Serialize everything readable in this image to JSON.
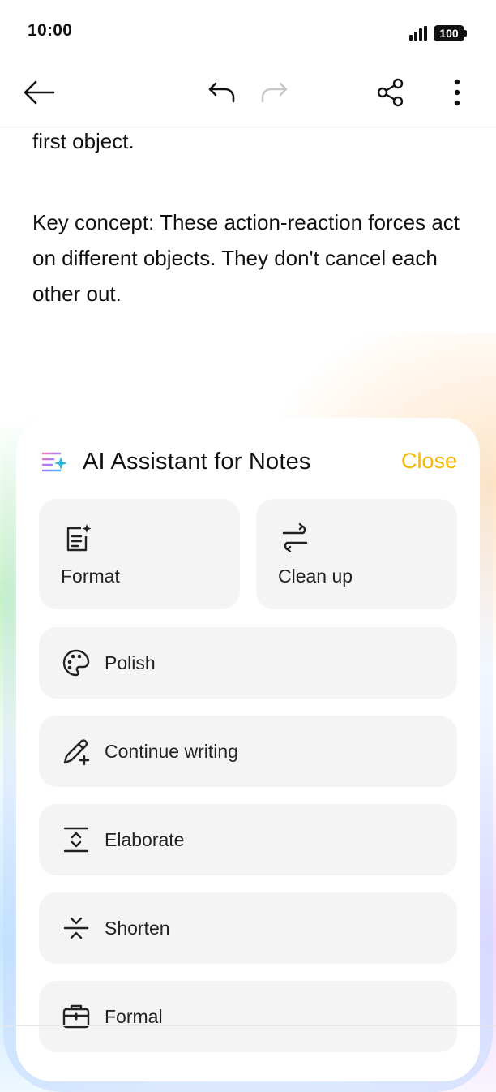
{
  "status_bar": {
    "time": "10:00",
    "battery": "100",
    "icons": [
      "signal-icon",
      "battery-icon"
    ]
  },
  "toolbar": {
    "icons": [
      "back-arrow-icon",
      "undo-icon",
      "redo-icon",
      "share-icon",
      "more-vertical-icon"
    ]
  },
  "note": {
    "line1": "first object.",
    "paragraph2": "Key concept: These action-reaction forces act on different objects. They don't cancel each other out."
  },
  "panel": {
    "title": "AI Assistant for Notes",
    "close_label": "Close",
    "accent": "#f2b705",
    "tiles": [
      {
        "label": "Format",
        "icon": "format-sparkle-icon"
      },
      {
        "label": "Clean up",
        "icon": "clean-up-arrows-icon"
      }
    ],
    "actions": [
      {
        "label": "Polish",
        "icon": "palette-icon"
      },
      {
        "label": "Continue writing",
        "icon": "pen-plus-icon"
      },
      {
        "label": "Elaborate",
        "icon": "expand-lines-icon"
      },
      {
        "label": "Shorten",
        "icon": "compress-lines-icon"
      },
      {
        "label": "Formal",
        "icon": "briefcase-icon"
      }
    ]
  }
}
